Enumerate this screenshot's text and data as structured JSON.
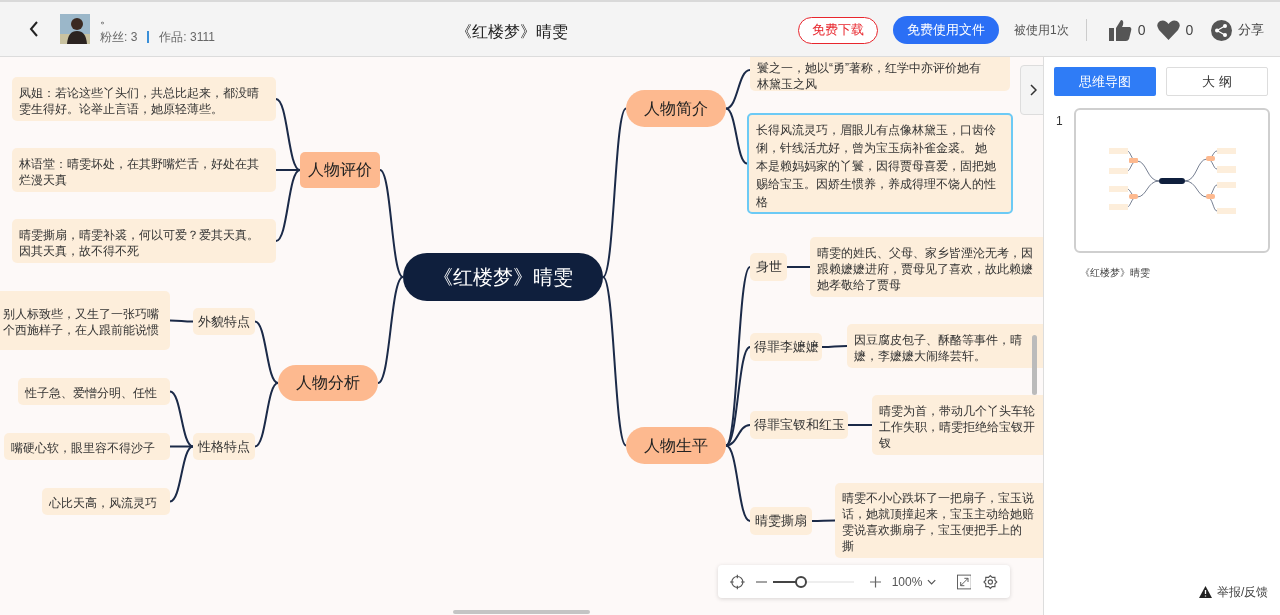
{
  "header": {
    "author_name": "。",
    "fans": "粉丝: 3",
    "works": "作品: 3111",
    "title": "《红楼梦》晴雯",
    "download_button": "免费下载",
    "use_button": "免费使用文件",
    "usage": "被使用1次",
    "likes": "0",
    "favorites": "0",
    "share": "分享"
  },
  "mindmap": {
    "root": "《红楼梦》晴雯",
    "branches": [
      {
        "label": "人物评价",
        "selected": false,
        "children": [
          {
            "lines": [
              "凤姐：若论这些丫头们，共总比起来，都没晴",
              "雯生得好。论举止言语，她原轻薄些。"
            ],
            "selected": false
          },
          {
            "lines": [
              "林语堂：晴雯坏处，在其野嘴烂舌，好处在其",
              "烂漫天真"
            ],
            "selected": false
          },
          {
            "lines": [
              "晴雯撕扇，晴雯补裘，何以可爱？爱其天真。",
              "因其天真，故不得不死"
            ],
            "selected": false
          }
        ]
      },
      {
        "label": "人物分析",
        "selected": false,
        "children": [
          {
            "label": "外貌特点",
            "selected": false,
            "children": [
              {
                "lines": [
                  "别人标致些，又生了一张巧嘴",
                  "个西施样子，在人跟前能说惯"
                ],
                "selected": false
              }
            ]
          },
          {
            "label": "性格特点",
            "selected": false,
            "children": [
              {
                "lines": [
                  "性子急、爱憎分明、任性"
                ],
                "selected": false
              },
              {
                "lines": [
                  "嘴硬心软，眼里容不得沙子"
                ],
                "selected": false
              },
              {
                "lines": [
                  "心比天高，风流灵巧"
                ],
                "selected": false
              }
            ]
          }
        ]
      },
      {
        "label": "人物简介",
        "selected": false,
        "children": [
          {
            "lines": [
              "鬟之一，她以“勇”著称，红学中亦评价她有",
              "林黛玉之风"
            ],
            "selected": false
          },
          {
            "lines": [
              "长得风流灵巧，眉眼儿有点像林黛玉，口齿伶",
              "俐，针线活尤好，曾为宝玉病补雀金裘。 她",
              "本是赖妈妈家的丫鬟，因得贾母喜爱，固把她",
              "赐给宝玉。因娇生惯养，养成得理不饶人的性",
              "格"
            ],
            "selected": true
          }
        ]
      },
      {
        "label": "人物生平",
        "selected": false,
        "children": [
          {
            "label": "身世",
            "selected": false,
            "children": [
              {
                "lines": [
                  "晴雯的姓氏、父母、家乡皆湮沦无考，因",
                  "跟赖嬷嬷进府，贾母见了喜欢，故此赖嬷",
                  "她孝敬给了贾母"
                ],
                "selected": false
              }
            ]
          },
          {
            "label": "得罪李嬷嬷",
            "selected": false,
            "children": [
              {
                "lines": [
                  "因豆腐皮包子、酥酪等事件，晴",
                  "嬷，李嬷嬷大闹绛芸轩。"
                ],
                "selected": false
              }
            ]
          },
          {
            "label": "得罪宝钗和红玉",
            "selected": false,
            "children": [
              {
                "lines": [
                  "晴雯为首，带动几个丫头车轮",
                  "工作失职，晴雯拒绝给宝钗开",
                  "钗"
                ],
                "selected": false
              }
            ]
          },
          {
            "label": "晴雯撕扇",
            "selected": false,
            "children": [
              {
                "lines": [
                  "晴雯不小心跌坏了一把扇子，宝玉说",
                  "话，她就顶撞起来，宝玉主动给她赔",
                  "雯说喜欢撕扇子，宝玉便把手上的",
                  "撕"
                ],
                "selected": false
              }
            ]
          }
        ]
      }
    ]
  },
  "zoom_bar": {
    "level": 0.29,
    "value": "100%"
  },
  "sidebar": {
    "tabs": [
      {
        "label": "思维导图",
        "selected": true
      },
      {
        "label": "大 纲",
        "selected": false
      }
    ],
    "pages": [
      {
        "number": "1",
        "caption": "《红楼梦》晴雯",
        "selected": true
      }
    ],
    "report": "举报/反馈"
  }
}
